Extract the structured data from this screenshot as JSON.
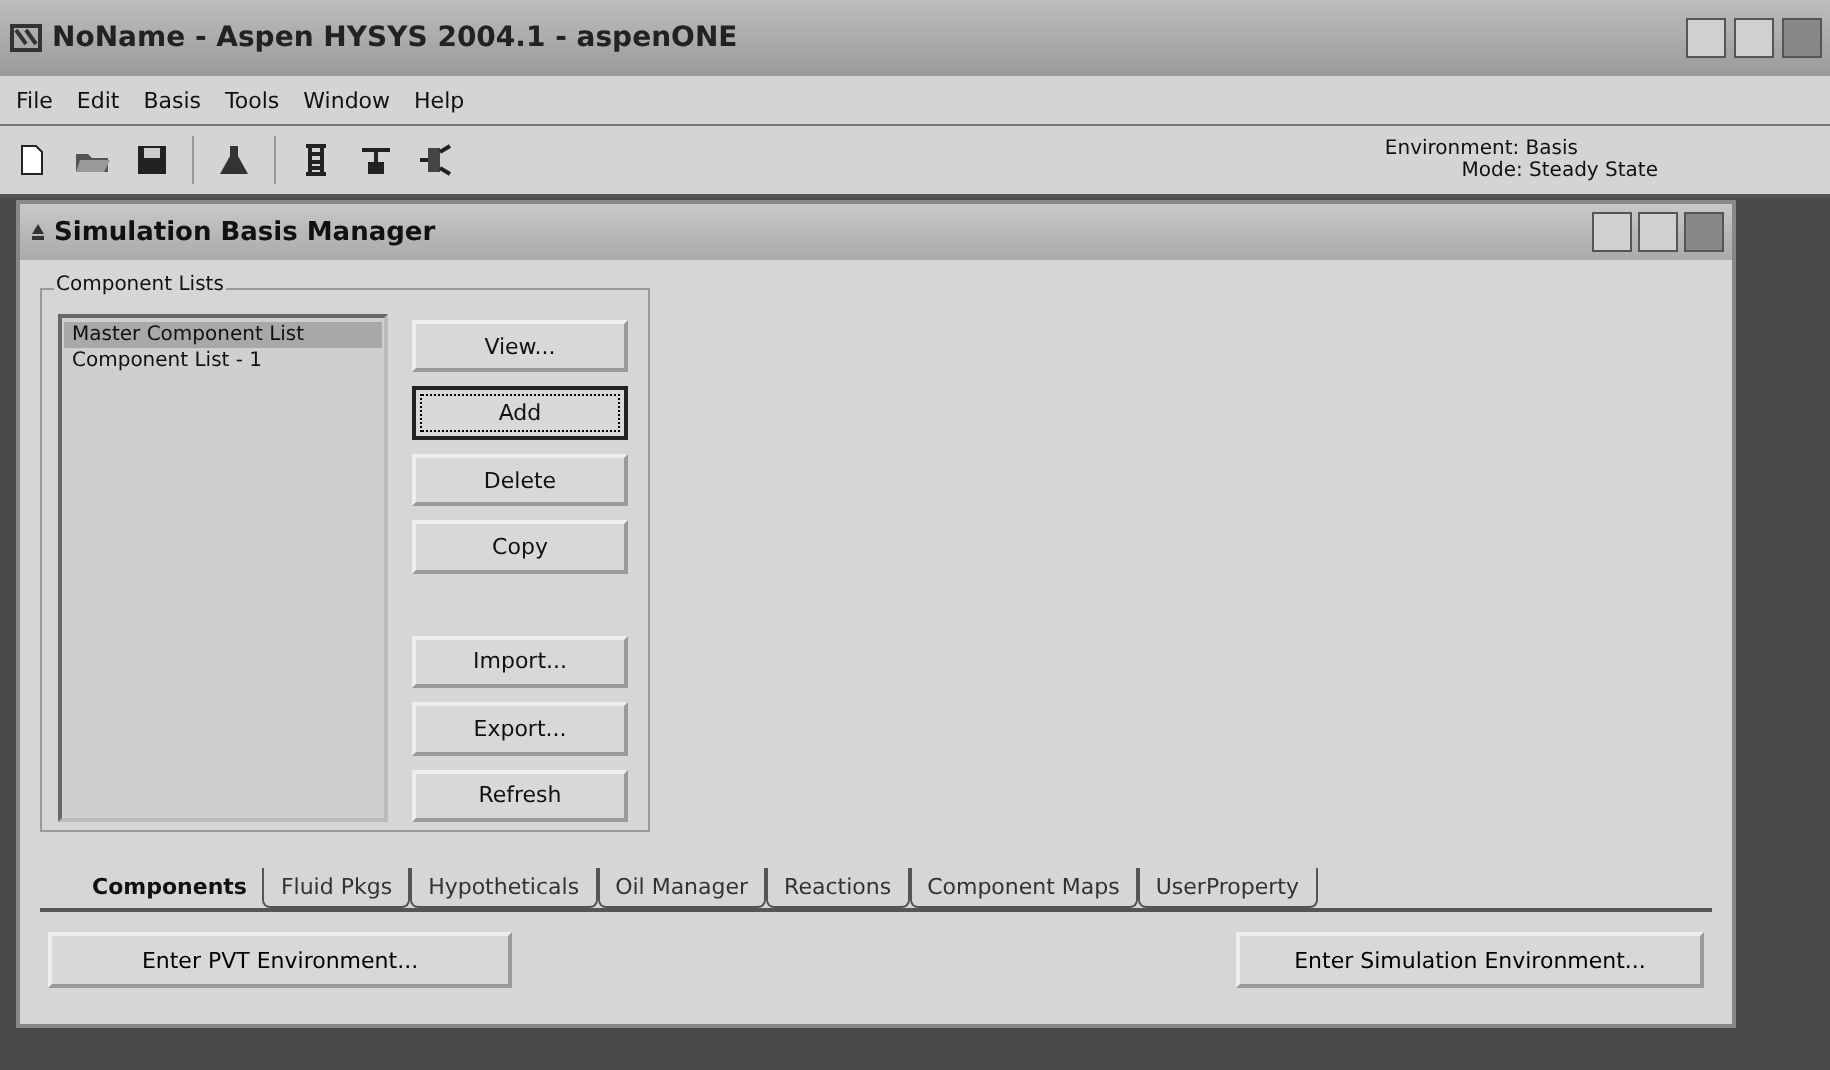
{
  "window": {
    "title": "NoName - Aspen HYSYS 2004.1 - aspenONE"
  },
  "menu": [
    "File",
    "Edit",
    "Basis",
    "Tools",
    "Window",
    "Help"
  ],
  "status": {
    "environment": "Environment: Basis",
    "mode": "Mode: Steady State"
  },
  "child_window": {
    "title": "Simulation Basis Manager",
    "group": {
      "title": "Component Lists",
      "items": [
        {
          "label": "Master Component List",
          "selected": true
        },
        {
          "label": "Component List - 1",
          "selected": false
        }
      ],
      "buttons": [
        {
          "label": "View...",
          "focused": false
        },
        {
          "label": "Add",
          "focused": true
        },
        {
          "label": "Delete",
          "focused": false
        },
        {
          "label": "Copy",
          "focused": false
        },
        {
          "label": "Import...",
          "focused": false
        },
        {
          "label": "Export...",
          "focused": false
        },
        {
          "label": "Refresh",
          "focused": false
        }
      ]
    },
    "tabs": [
      {
        "label": "Components",
        "selected": true
      },
      {
        "label": "Fluid Pkgs",
        "selected": false
      },
      {
        "label": "Hypotheticals",
        "selected": false
      },
      {
        "label": "Oil Manager",
        "selected": false
      },
      {
        "label": "Reactions",
        "selected": false
      },
      {
        "label": "Component Maps",
        "selected": false
      },
      {
        "label": "UserProperty",
        "selected": false
      }
    ],
    "footer_buttons": [
      "Enter PVT Environment...",
      "Enter Simulation Environment..."
    ]
  }
}
